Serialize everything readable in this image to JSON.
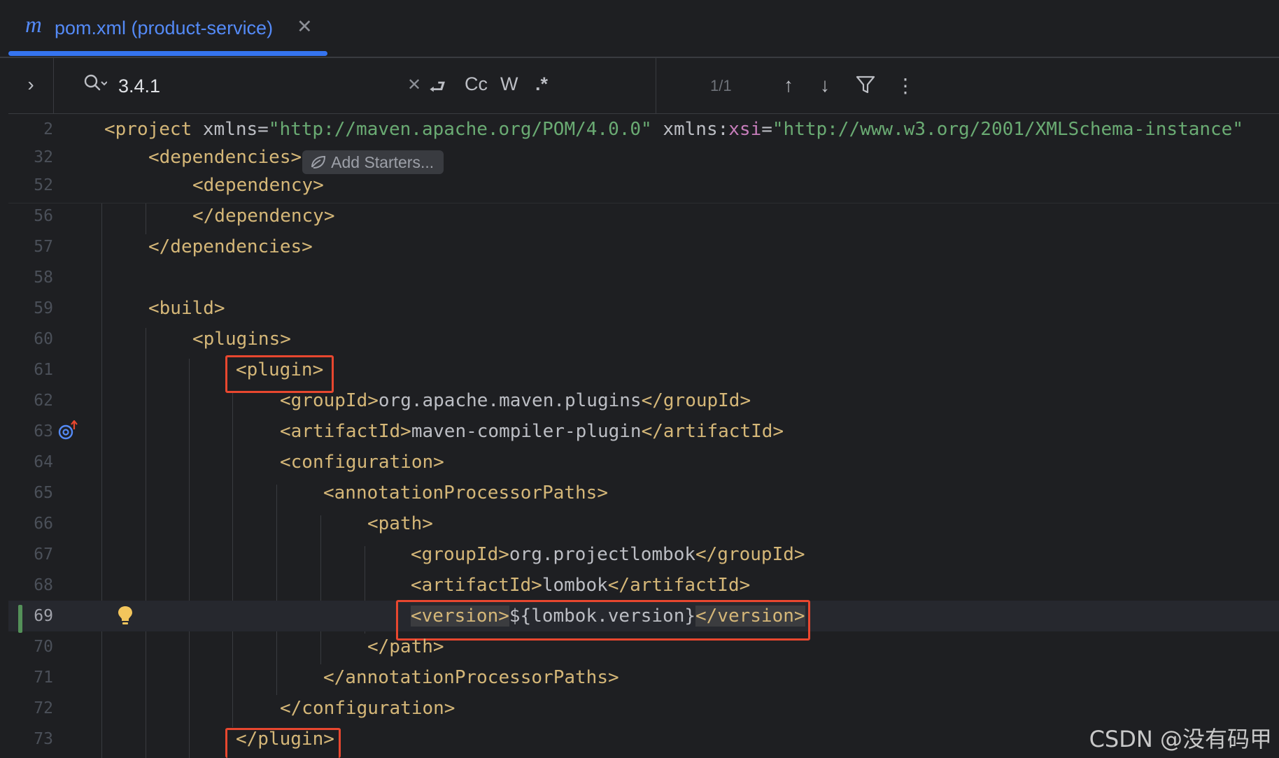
{
  "tab": {
    "icon_glyph": "m",
    "title": "pom.xml (product-service)",
    "close_glyph": "✕",
    "accent": "#3574f0"
  },
  "search": {
    "expand_glyph": "›",
    "query": "3.4.1",
    "clear_glyph": "✕",
    "wrap_glyph": "⮐",
    "match_case_label": "Cc",
    "words_label": "W",
    "regex_label": ".*",
    "result_count": "1/1",
    "prev_glyph": "↑",
    "next_glyph": "↓",
    "filter_glyph": "⛉",
    "more_glyph": "⋮"
  },
  "editor": {
    "inlay_hint": "Add Starters...",
    "lines": {
      "l2": {
        "num": "2"
      },
      "l32": {
        "num": "32"
      },
      "l52": {
        "num": "52"
      },
      "l56": {
        "num": "56"
      },
      "l57": {
        "num": "57"
      },
      "l58": {
        "num": "58"
      },
      "l59": {
        "num": "59"
      },
      "l60": {
        "num": "60"
      },
      "l61": {
        "num": "61"
      },
      "l62": {
        "num": "62"
      },
      "l63": {
        "num": "63"
      },
      "l64": {
        "num": "64"
      },
      "l65": {
        "num": "65"
      },
      "l66": {
        "num": "66"
      },
      "l67": {
        "num": "67"
      },
      "l68": {
        "num": "68"
      },
      "l69": {
        "num": "69"
      },
      "l70": {
        "num": "70"
      },
      "l71": {
        "num": "71"
      },
      "l72": {
        "num": "72"
      },
      "l73": {
        "num": "73"
      }
    },
    "code": {
      "project_open": "<project",
      "xmlns_attr": " xmlns=",
      "xmlns_val": "\"http://maven.apache.org/POM/4.0.0\"",
      "xmlns_xsi_attr": " xmlns:",
      "xsi_prefix": "xsi",
      "eq": "=",
      "xsi_val": "\"http://www.w3.org/2001/XMLSchema-instance\"",
      "dependencies_open": "<dependencies>",
      "dependency_open": "<dependency>",
      "dependency_close": "</dependency>",
      "dependencies_close": "</dependencies>",
      "build_open": "<build>",
      "plugins_open": "<plugins>",
      "plugin_open": "<plugin>",
      "groupId_open": "<groupId>",
      "groupId_close": "</groupId>",
      "maven_group": "org.apache.maven.plugins",
      "artifactId_open": "<artifactId>",
      "artifactId_close": "</artifactId>",
      "compiler_artifact": "maven-compiler-plugin",
      "configuration_open": "<configuration>",
      "app_open": "<annotationProcessorPaths>",
      "path_open": "<path>",
      "lombok_group": "org.projectlombok",
      "lombok_artifact": "lombok",
      "version_open": "<version>",
      "version_value": "${lombok.version}",
      "version_close": "</version>",
      "path_close": "</path>",
      "app_close": "</annotationProcessorPaths>",
      "configuration_close": "</configuration>",
      "plugin_close": "</plugin>"
    }
  },
  "watermark": "CSDN @没有码甲",
  "colors": {
    "background": "#1e1f22",
    "tag": "#d5b778",
    "string": "#6aab73",
    "namespace": "#c77dbb",
    "highlight_box": "#e8472f"
  }
}
